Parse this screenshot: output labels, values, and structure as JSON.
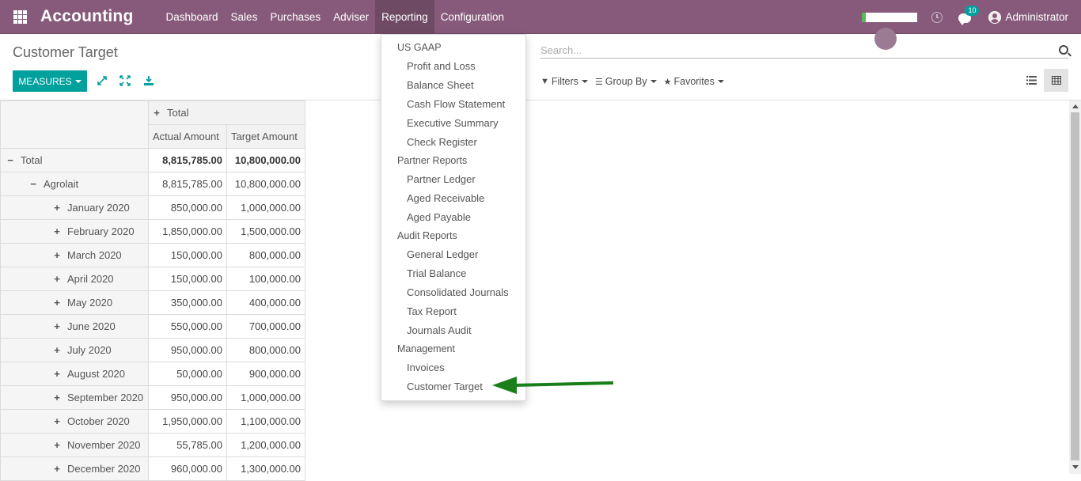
{
  "navbar": {
    "brand": "Accounting",
    "menu": [
      "Dashboard",
      "Sales",
      "Purchases",
      "Adviser",
      "Reporting",
      "Configuration"
    ],
    "active_menu": "Reporting",
    "chat_count": "10",
    "user": "Administrator"
  },
  "control_panel": {
    "breadcrumb": "Customer Target",
    "search_placeholder": "Search...",
    "measures_label": "MEASURES",
    "filters_label": "Filters",
    "groupby_label": "Group By",
    "favorites_label": "Favorites"
  },
  "reporting_menu": {
    "sections": [
      {
        "header": "US GAAP",
        "items": [
          "Profit and Loss",
          "Balance Sheet",
          "Cash Flow Statement",
          "Executive Summary",
          "Check Register"
        ]
      },
      {
        "header": "Partner Reports",
        "items": [
          "Partner Ledger",
          "Aged Receivable",
          "Aged Payable"
        ]
      },
      {
        "header": "Audit Reports",
        "items": [
          "General Ledger",
          "Trial Balance",
          "Consolidated Journals",
          "Tax Report",
          "Journals Audit"
        ]
      },
      {
        "header": "Management",
        "items": [
          "Invoices",
          "Customer Target"
        ]
      }
    ]
  },
  "pivot": {
    "col_group": "Total",
    "measures": [
      "Actual Amount",
      "Target Amount"
    ],
    "total_row": {
      "label": "Total",
      "actual": "8,815,785.00",
      "target": "10,800,000.00"
    },
    "group_row": {
      "label": "Agrolait",
      "actual": "8,815,785.00",
      "target": "10,800,000.00"
    },
    "rows": [
      {
        "label": "January 2020",
        "actual": "850,000.00",
        "target": "1,000,000.00"
      },
      {
        "label": "February 2020",
        "actual": "1,850,000.00",
        "target": "1,500,000.00"
      },
      {
        "label": "March 2020",
        "actual": "150,000.00",
        "target": "800,000.00"
      },
      {
        "label": "April 2020",
        "actual": "150,000.00",
        "target": "100,000.00"
      },
      {
        "label": "May 2020",
        "actual": "350,000.00",
        "target": "400,000.00"
      },
      {
        "label": "June 2020",
        "actual": "550,000.00",
        "target": "700,000.00"
      },
      {
        "label": "July 2020",
        "actual": "950,000.00",
        "target": "800,000.00"
      },
      {
        "label": "August 2020",
        "actual": "50,000.00",
        "target": "900,000.00"
      },
      {
        "label": "September 2020",
        "actual": "950,000.00",
        "target": "1,000,000.00"
      },
      {
        "label": "October 2020",
        "actual": "1,950,000.00",
        "target": "1,100,000.00"
      },
      {
        "label": "November 2020",
        "actual": "55,785.00",
        "target": "1,200,000.00"
      },
      {
        "label": "December 2020",
        "actual": "960,000.00",
        "target": "1,300,000.00"
      }
    ]
  },
  "colors": {
    "navbar": "#875a7b",
    "primary_button": "#00a09d",
    "arrow": "#1a7f1a"
  }
}
